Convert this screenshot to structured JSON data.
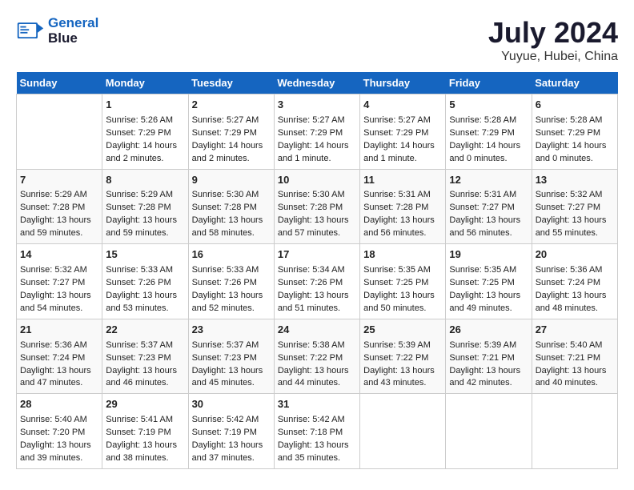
{
  "header": {
    "logo_line1": "General",
    "logo_line2": "Blue",
    "month_title": "July 2024",
    "location": "Yuyue, Hubei, China"
  },
  "days_of_week": [
    "Sunday",
    "Monday",
    "Tuesday",
    "Wednesday",
    "Thursday",
    "Friday",
    "Saturday"
  ],
  "weeks": [
    [
      {
        "day": "",
        "text": ""
      },
      {
        "day": "1",
        "text": "Sunrise: 5:26 AM\nSunset: 7:29 PM\nDaylight: 14 hours\nand 2 minutes."
      },
      {
        "day": "2",
        "text": "Sunrise: 5:27 AM\nSunset: 7:29 PM\nDaylight: 14 hours\nand 2 minutes."
      },
      {
        "day": "3",
        "text": "Sunrise: 5:27 AM\nSunset: 7:29 PM\nDaylight: 14 hours\nand 1 minute."
      },
      {
        "day": "4",
        "text": "Sunrise: 5:27 AM\nSunset: 7:29 PM\nDaylight: 14 hours\nand 1 minute."
      },
      {
        "day": "5",
        "text": "Sunrise: 5:28 AM\nSunset: 7:29 PM\nDaylight: 14 hours\nand 0 minutes."
      },
      {
        "day": "6",
        "text": "Sunrise: 5:28 AM\nSunset: 7:29 PM\nDaylight: 14 hours\nand 0 minutes."
      }
    ],
    [
      {
        "day": "7",
        "text": "Sunrise: 5:29 AM\nSunset: 7:28 PM\nDaylight: 13 hours\nand 59 minutes."
      },
      {
        "day": "8",
        "text": "Sunrise: 5:29 AM\nSunset: 7:28 PM\nDaylight: 13 hours\nand 59 minutes."
      },
      {
        "day": "9",
        "text": "Sunrise: 5:30 AM\nSunset: 7:28 PM\nDaylight: 13 hours\nand 58 minutes."
      },
      {
        "day": "10",
        "text": "Sunrise: 5:30 AM\nSunset: 7:28 PM\nDaylight: 13 hours\nand 57 minutes."
      },
      {
        "day": "11",
        "text": "Sunrise: 5:31 AM\nSunset: 7:28 PM\nDaylight: 13 hours\nand 56 minutes."
      },
      {
        "day": "12",
        "text": "Sunrise: 5:31 AM\nSunset: 7:27 PM\nDaylight: 13 hours\nand 56 minutes."
      },
      {
        "day": "13",
        "text": "Sunrise: 5:32 AM\nSunset: 7:27 PM\nDaylight: 13 hours\nand 55 minutes."
      }
    ],
    [
      {
        "day": "14",
        "text": "Sunrise: 5:32 AM\nSunset: 7:27 PM\nDaylight: 13 hours\nand 54 minutes."
      },
      {
        "day": "15",
        "text": "Sunrise: 5:33 AM\nSunset: 7:26 PM\nDaylight: 13 hours\nand 53 minutes."
      },
      {
        "day": "16",
        "text": "Sunrise: 5:33 AM\nSunset: 7:26 PM\nDaylight: 13 hours\nand 52 minutes."
      },
      {
        "day": "17",
        "text": "Sunrise: 5:34 AM\nSunset: 7:26 PM\nDaylight: 13 hours\nand 51 minutes."
      },
      {
        "day": "18",
        "text": "Sunrise: 5:35 AM\nSunset: 7:25 PM\nDaylight: 13 hours\nand 50 minutes."
      },
      {
        "day": "19",
        "text": "Sunrise: 5:35 AM\nSunset: 7:25 PM\nDaylight: 13 hours\nand 49 minutes."
      },
      {
        "day": "20",
        "text": "Sunrise: 5:36 AM\nSunset: 7:24 PM\nDaylight: 13 hours\nand 48 minutes."
      }
    ],
    [
      {
        "day": "21",
        "text": "Sunrise: 5:36 AM\nSunset: 7:24 PM\nDaylight: 13 hours\nand 47 minutes."
      },
      {
        "day": "22",
        "text": "Sunrise: 5:37 AM\nSunset: 7:23 PM\nDaylight: 13 hours\nand 46 minutes."
      },
      {
        "day": "23",
        "text": "Sunrise: 5:37 AM\nSunset: 7:23 PM\nDaylight: 13 hours\nand 45 minutes."
      },
      {
        "day": "24",
        "text": "Sunrise: 5:38 AM\nSunset: 7:22 PM\nDaylight: 13 hours\nand 44 minutes."
      },
      {
        "day": "25",
        "text": "Sunrise: 5:39 AM\nSunset: 7:22 PM\nDaylight: 13 hours\nand 43 minutes."
      },
      {
        "day": "26",
        "text": "Sunrise: 5:39 AM\nSunset: 7:21 PM\nDaylight: 13 hours\nand 42 minutes."
      },
      {
        "day": "27",
        "text": "Sunrise: 5:40 AM\nSunset: 7:21 PM\nDaylight: 13 hours\nand 40 minutes."
      }
    ],
    [
      {
        "day": "28",
        "text": "Sunrise: 5:40 AM\nSunset: 7:20 PM\nDaylight: 13 hours\nand 39 minutes."
      },
      {
        "day": "29",
        "text": "Sunrise: 5:41 AM\nSunset: 7:19 PM\nDaylight: 13 hours\nand 38 minutes."
      },
      {
        "day": "30",
        "text": "Sunrise: 5:42 AM\nSunset: 7:19 PM\nDaylight: 13 hours\nand 37 minutes."
      },
      {
        "day": "31",
        "text": "Sunrise: 5:42 AM\nSunset: 7:18 PM\nDaylight: 13 hours\nand 35 minutes."
      },
      {
        "day": "",
        "text": ""
      },
      {
        "day": "",
        "text": ""
      },
      {
        "day": "",
        "text": ""
      }
    ]
  ]
}
